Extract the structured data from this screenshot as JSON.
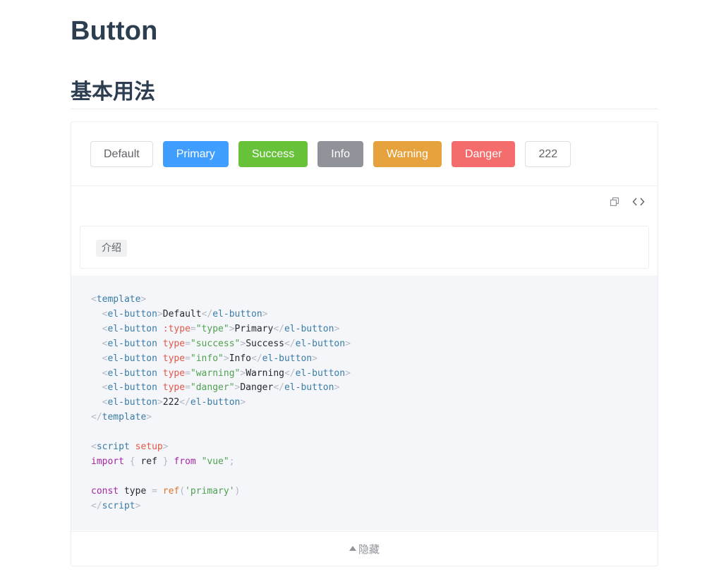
{
  "page": {
    "title": "Button",
    "section_title": "基本用法"
  },
  "buttons": [
    {
      "label": "Default",
      "type": "default"
    },
    {
      "label": "Primary",
      "type": "primary"
    },
    {
      "label": "Success",
      "type": "success"
    },
    {
      "label": "Info",
      "type": "info"
    },
    {
      "label": "Warning",
      "type": "warning"
    },
    {
      "label": "Danger",
      "type": "danger"
    },
    {
      "label": "222",
      "type": "default"
    }
  ],
  "toolbar": {
    "copy_icon": "copy-icon",
    "code_icon": "code-toggle-icon"
  },
  "description": {
    "tag": "介绍"
  },
  "code_lines": [
    [
      [
        "p",
        "<"
      ],
      [
        "t",
        "template"
      ],
      [
        "p",
        ">"
      ]
    ],
    [
      [
        "x",
        "  "
      ],
      [
        "p",
        "<"
      ],
      [
        "t",
        "el-button"
      ],
      [
        "p",
        ">"
      ],
      [
        "x",
        "Default"
      ],
      [
        "p",
        "</"
      ],
      [
        "t",
        "el-button"
      ],
      [
        "p",
        ">"
      ]
    ],
    [
      [
        "x",
        "  "
      ],
      [
        "p",
        "<"
      ],
      [
        "t",
        "el-button "
      ],
      [
        "a",
        ":type"
      ],
      [
        "p",
        "="
      ],
      [
        "s",
        "\"type\""
      ],
      [
        "p",
        ">"
      ],
      [
        "x",
        "Primary"
      ],
      [
        "p",
        "</"
      ],
      [
        "t",
        "el-button"
      ],
      [
        "p",
        ">"
      ]
    ],
    [
      [
        "x",
        "  "
      ],
      [
        "p",
        "<"
      ],
      [
        "t",
        "el-button "
      ],
      [
        "a",
        "type"
      ],
      [
        "p",
        "="
      ],
      [
        "s",
        "\"success\""
      ],
      [
        "p",
        ">"
      ],
      [
        "x",
        "Success"
      ],
      [
        "p",
        "</"
      ],
      [
        "t",
        "el-button"
      ],
      [
        "p",
        ">"
      ]
    ],
    [
      [
        "x",
        "  "
      ],
      [
        "p",
        "<"
      ],
      [
        "t",
        "el-button "
      ],
      [
        "a",
        "type"
      ],
      [
        "p",
        "="
      ],
      [
        "s",
        "\"info\""
      ],
      [
        "p",
        ">"
      ],
      [
        "x",
        "Info"
      ],
      [
        "p",
        "</"
      ],
      [
        "t",
        "el-button"
      ],
      [
        "p",
        ">"
      ]
    ],
    [
      [
        "x",
        "  "
      ],
      [
        "p",
        "<"
      ],
      [
        "t",
        "el-button "
      ],
      [
        "a",
        "type"
      ],
      [
        "p",
        "="
      ],
      [
        "s",
        "\"warning\""
      ],
      [
        "p",
        ">"
      ],
      [
        "x",
        "Warning"
      ],
      [
        "p",
        "</"
      ],
      [
        "t",
        "el-button"
      ],
      [
        "p",
        ">"
      ]
    ],
    [
      [
        "x",
        "  "
      ],
      [
        "p",
        "<"
      ],
      [
        "t",
        "el-button "
      ],
      [
        "a",
        "type"
      ],
      [
        "p",
        "="
      ],
      [
        "s",
        "\"danger\""
      ],
      [
        "p",
        ">"
      ],
      [
        "x",
        "Danger"
      ],
      [
        "p",
        "</"
      ],
      [
        "t",
        "el-button"
      ],
      [
        "p",
        ">"
      ]
    ],
    [
      [
        "x",
        "  "
      ],
      [
        "p",
        "<"
      ],
      [
        "t",
        "el-button"
      ],
      [
        "p",
        ">"
      ],
      [
        "x",
        "222"
      ],
      [
        "p",
        "</"
      ],
      [
        "t",
        "el-button"
      ],
      [
        "p",
        ">"
      ]
    ],
    [
      [
        "p",
        "</"
      ],
      [
        "t",
        "template"
      ],
      [
        "p",
        ">"
      ]
    ],
    [],
    [
      [
        "p",
        "<"
      ],
      [
        "t",
        "script "
      ],
      [
        "a",
        "setup"
      ],
      [
        "p",
        ">"
      ]
    ],
    [
      [
        "k",
        "import"
      ],
      [
        "p",
        " { "
      ],
      [
        "x",
        "ref"
      ],
      [
        "p",
        " } "
      ],
      [
        "k",
        "from"
      ],
      [
        "x",
        " "
      ],
      [
        "s",
        "\"vue\""
      ],
      [
        "p",
        ";"
      ]
    ],
    [],
    [
      [
        "k",
        "const"
      ],
      [
        "x",
        " type "
      ],
      [
        "p",
        "= "
      ],
      [
        "f",
        "ref"
      ],
      [
        "p",
        "("
      ],
      [
        "s",
        "'primary'"
      ],
      [
        "p",
        ")"
      ]
    ],
    [
      [
        "p",
        "</"
      ],
      [
        "t",
        "script"
      ],
      [
        "p",
        ">"
      ]
    ]
  ],
  "hide_label": "隐藏"
}
